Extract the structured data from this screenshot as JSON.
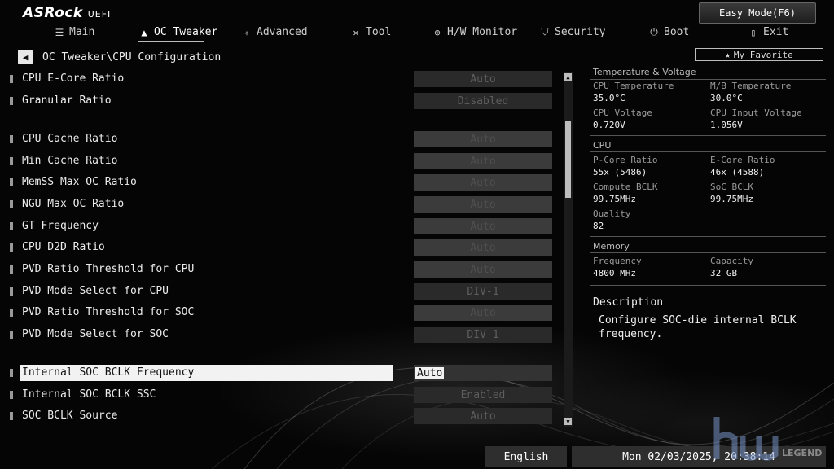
{
  "brand": {
    "name": "ASRock",
    "suffix": "UEFI"
  },
  "easy_mode_label": "Easy Mode(F6)",
  "menu": [
    {
      "label": "Main",
      "icon": "list-icon"
    },
    {
      "label": "OC Tweaker",
      "icon": "rocket-icon"
    },
    {
      "label": "Advanced",
      "icon": "star-wand-icon"
    },
    {
      "label": "Tool",
      "icon": "tools-icon"
    },
    {
      "label": "H/W Monitor",
      "icon": "crosshair-icon"
    },
    {
      "label": "Security",
      "icon": "shield-icon"
    },
    {
      "label": "Boot",
      "icon": "power-icon"
    },
    {
      "label": "Exit",
      "icon": "exit-door-icon"
    }
  ],
  "breadcrumb": "OC Tweaker\\CPU Configuration",
  "my_favorite_label": "My Favorite",
  "settings": [
    {
      "label": "CPU E-Core Ratio",
      "value": "Auto"
    },
    {
      "label": "Granular Ratio",
      "value": "Disabled"
    },
    {
      "label": "CPU Cache  Ratio",
      "value": "Auto"
    },
    {
      "label": "Min Cache  Ratio",
      "value": "Auto"
    },
    {
      "label": "MemSS Max OC Ratio",
      "value": "Auto"
    },
    {
      "label": "NGU Max OC Ratio",
      "value": "Auto"
    },
    {
      "label": "GT Frequency",
      "value": "Auto"
    },
    {
      "label": "CPU D2D Ratio",
      "value": "Auto"
    },
    {
      "label": "PVD Ratio Threshold for CPU",
      "value": "Auto"
    },
    {
      "label": "PVD Mode Select for CPU",
      "value": "DIV-1"
    },
    {
      "label": "PVD Ratio Threshold for SOC",
      "value": "Auto"
    },
    {
      "label": "PVD Mode Select for SOC",
      "value": "DIV-1"
    },
    {
      "label": "Internal SOC BCLK Frequency",
      "value": "Auto"
    },
    {
      "label": "Internal SOC BCLK SSC",
      "value": "Enabled"
    },
    {
      "label": "SOC BCLK Source",
      "value": "Auto"
    }
  ],
  "panel": {
    "temp_voltage": {
      "title": "Temperature & Voltage",
      "cpu_temp_label": "CPU Temperature",
      "cpu_temp": "35.0°C",
      "mb_temp_label": "M/B Temperature",
      "mb_temp": "30.0°C",
      "cpu_volt_label": "CPU Voltage",
      "cpu_volt": "0.720V",
      "cpu_in_volt_label": "CPU Input Voltage",
      "cpu_in_volt": "1.056V"
    },
    "cpu": {
      "title": "CPU",
      "pcore_label": "P-Core Ratio",
      "pcore": "55x (5486)",
      "ecore_label": "E-Core Ratio",
      "ecore": "46x (4588)",
      "compute_bclk_label": "Compute BCLK",
      "compute_bclk": "99.75MHz",
      "soc_bclk_label": "SoC BCLK",
      "soc_bclk": "99.75MHz",
      "quality_label": "Quality",
      "quality": "82"
    },
    "memory": {
      "title": "Memory",
      "freq_label": "Frequency",
      "freq": "4800 MHz",
      "cap_label": "Capacity",
      "cap": "32 GB"
    }
  },
  "description": {
    "title": "Description",
    "text": "Configure SOC-die internal BCLK frequency."
  },
  "language": "English",
  "datetime": "Mon 02/03/2025, 20:38:14",
  "watermark": "LEGEND"
}
